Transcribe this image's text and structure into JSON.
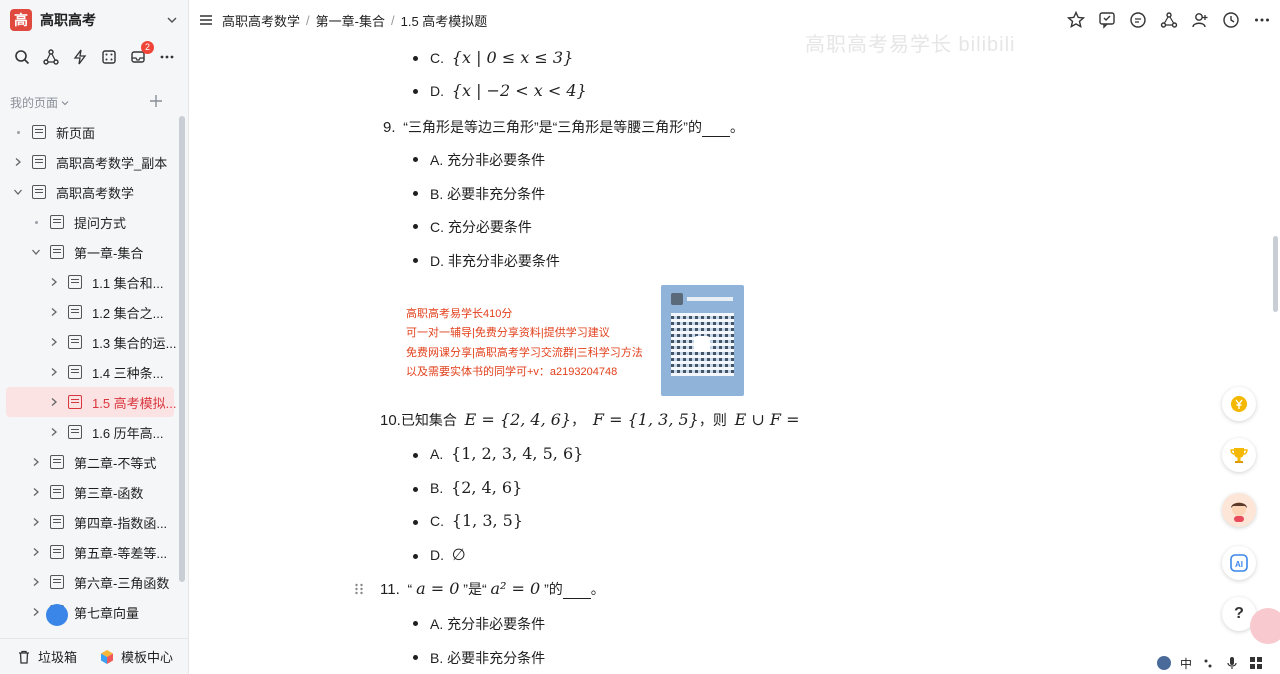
{
  "workspace": {
    "logo": "高",
    "name": "高职高考"
  },
  "sidebar": {
    "notification_count": "2",
    "my_pages_label": "我的页面",
    "items": [
      {
        "label": "新页面",
        "level": 0,
        "toggle": "dot"
      },
      {
        "label": "高职高考数学_副本",
        "level": 0,
        "toggle": "collapsed"
      },
      {
        "label": "高职高考数学",
        "level": 0,
        "toggle": "expanded"
      },
      {
        "label": "提问方式",
        "level": 1,
        "toggle": "dot"
      },
      {
        "label": "第一章-集合",
        "level": 1,
        "toggle": "expanded"
      },
      {
        "label": "1.1 集合和...",
        "level": 2,
        "toggle": "collapsed"
      },
      {
        "label": "1.2 集合之...",
        "level": 2,
        "toggle": "collapsed"
      },
      {
        "label": "1.3 集合的运...",
        "level": 2,
        "toggle": "collapsed"
      },
      {
        "label": "1.4 三种条...",
        "level": 2,
        "toggle": "collapsed"
      },
      {
        "label": "1.5 高考模拟...",
        "level": 2,
        "toggle": "collapsed",
        "active": true
      },
      {
        "label": "1.6 历年高...",
        "level": 2,
        "toggle": "collapsed"
      },
      {
        "label": "第二章-不等式",
        "level": 1,
        "toggle": "collapsed"
      },
      {
        "label": "第三章-函数",
        "level": 1,
        "toggle": "collapsed"
      },
      {
        "label": "第四章-指数函...",
        "level": 1,
        "toggle": "collapsed"
      },
      {
        "label": "第五章-等差等...",
        "level": 1,
        "toggle": "collapsed"
      },
      {
        "label": "第六章-三角函数",
        "level": 1,
        "toggle": "collapsed"
      },
      {
        "label": "第七章向量",
        "level": 1,
        "toggle": "collapsed"
      }
    ],
    "footer": {
      "trash": "垃圾箱",
      "templates": "模板中心"
    }
  },
  "breadcrumb": [
    "高职高考数学",
    "第一章-集合",
    "1.5 高考模拟题"
  ],
  "watermark": "高职高考易学长 bilibili",
  "content": {
    "q8_options": {
      "c": {
        "label": "C.",
        "math": "{x | 0 ≤ x ≤ 3}"
      },
      "d": {
        "label": "D.",
        "math": "{x | −2 < x < 4}"
      }
    },
    "q9": {
      "number": "9.",
      "stem": "“三角形是等边三角形”是“三角形是等腰三角形”的",
      "end": "。",
      "options": [
        "A. 充分非必要条件",
        "B. 必要非充分条件",
        "C. 充分必要条件",
        "D. 非充分非必要条件"
      ]
    },
    "ad": {
      "line1": "高职高考易学长410分",
      "line2": "可一对一辅导|免费分享资料|提供学习建议",
      "line3": "免费网课分享|高职高考学习交流群|三科学习方法",
      "line4": "以及需要实体书的同学可+v：a2193204748"
    },
    "q10": {
      "number": "10.",
      "stem_pre": "已知集合",
      "set_e": "E = {2, 4, 6}",
      "comma": "，",
      "set_f": "F = {1, 3, 5}",
      "then": "，则",
      "expr": "E ∪ F =",
      "options": [
        {
          "label": "A.",
          "math": "{1, 2, 3, 4, 5, 6}"
        },
        {
          "label": "B.",
          "math": "{2, 4, 6}"
        },
        {
          "label": "C.",
          "math": "{1, 3, 5}"
        },
        {
          "label": "D.",
          "math": "∅"
        }
      ]
    },
    "q11": {
      "number": "11.",
      "open_q": "“",
      "cond1": "a = 0",
      "mid": "”是“",
      "cond2": "a² = 0",
      "close": "”的",
      "end": "。",
      "options": [
        "A. 充分非必要条件",
        "B. 必要非充分条件"
      ]
    }
  },
  "tray": {
    "ime": "中"
  },
  "help": "?"
}
